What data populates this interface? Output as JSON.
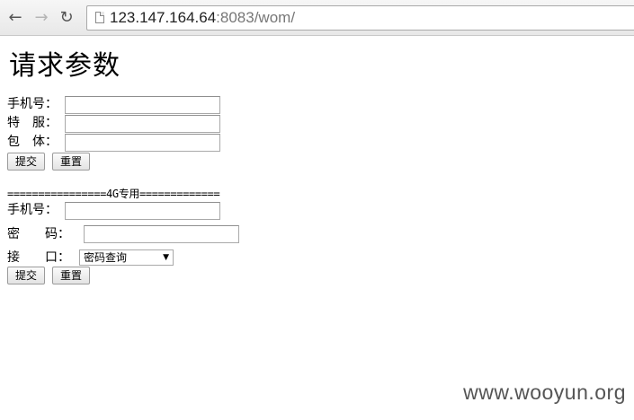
{
  "browser": {
    "url_host": "123.147.164.64",
    "url_rest": ":8083/wom/"
  },
  "page": {
    "title": "请求参数",
    "form1": {
      "phone_label": "手机号：",
      "service_label": "特　服：",
      "package_label": "包　体：",
      "submit_label": "提交",
      "reset_label": "重置"
    },
    "separator": "================4G专用=============",
    "form2": {
      "phone_label": "手机号：",
      "password_label": "密　　码：",
      "interface_label": "接　　口：",
      "interface_selected": "密码查询",
      "submit_label": "提交",
      "reset_label": "重置"
    }
  },
  "watermark": "www.wooyun.org"
}
